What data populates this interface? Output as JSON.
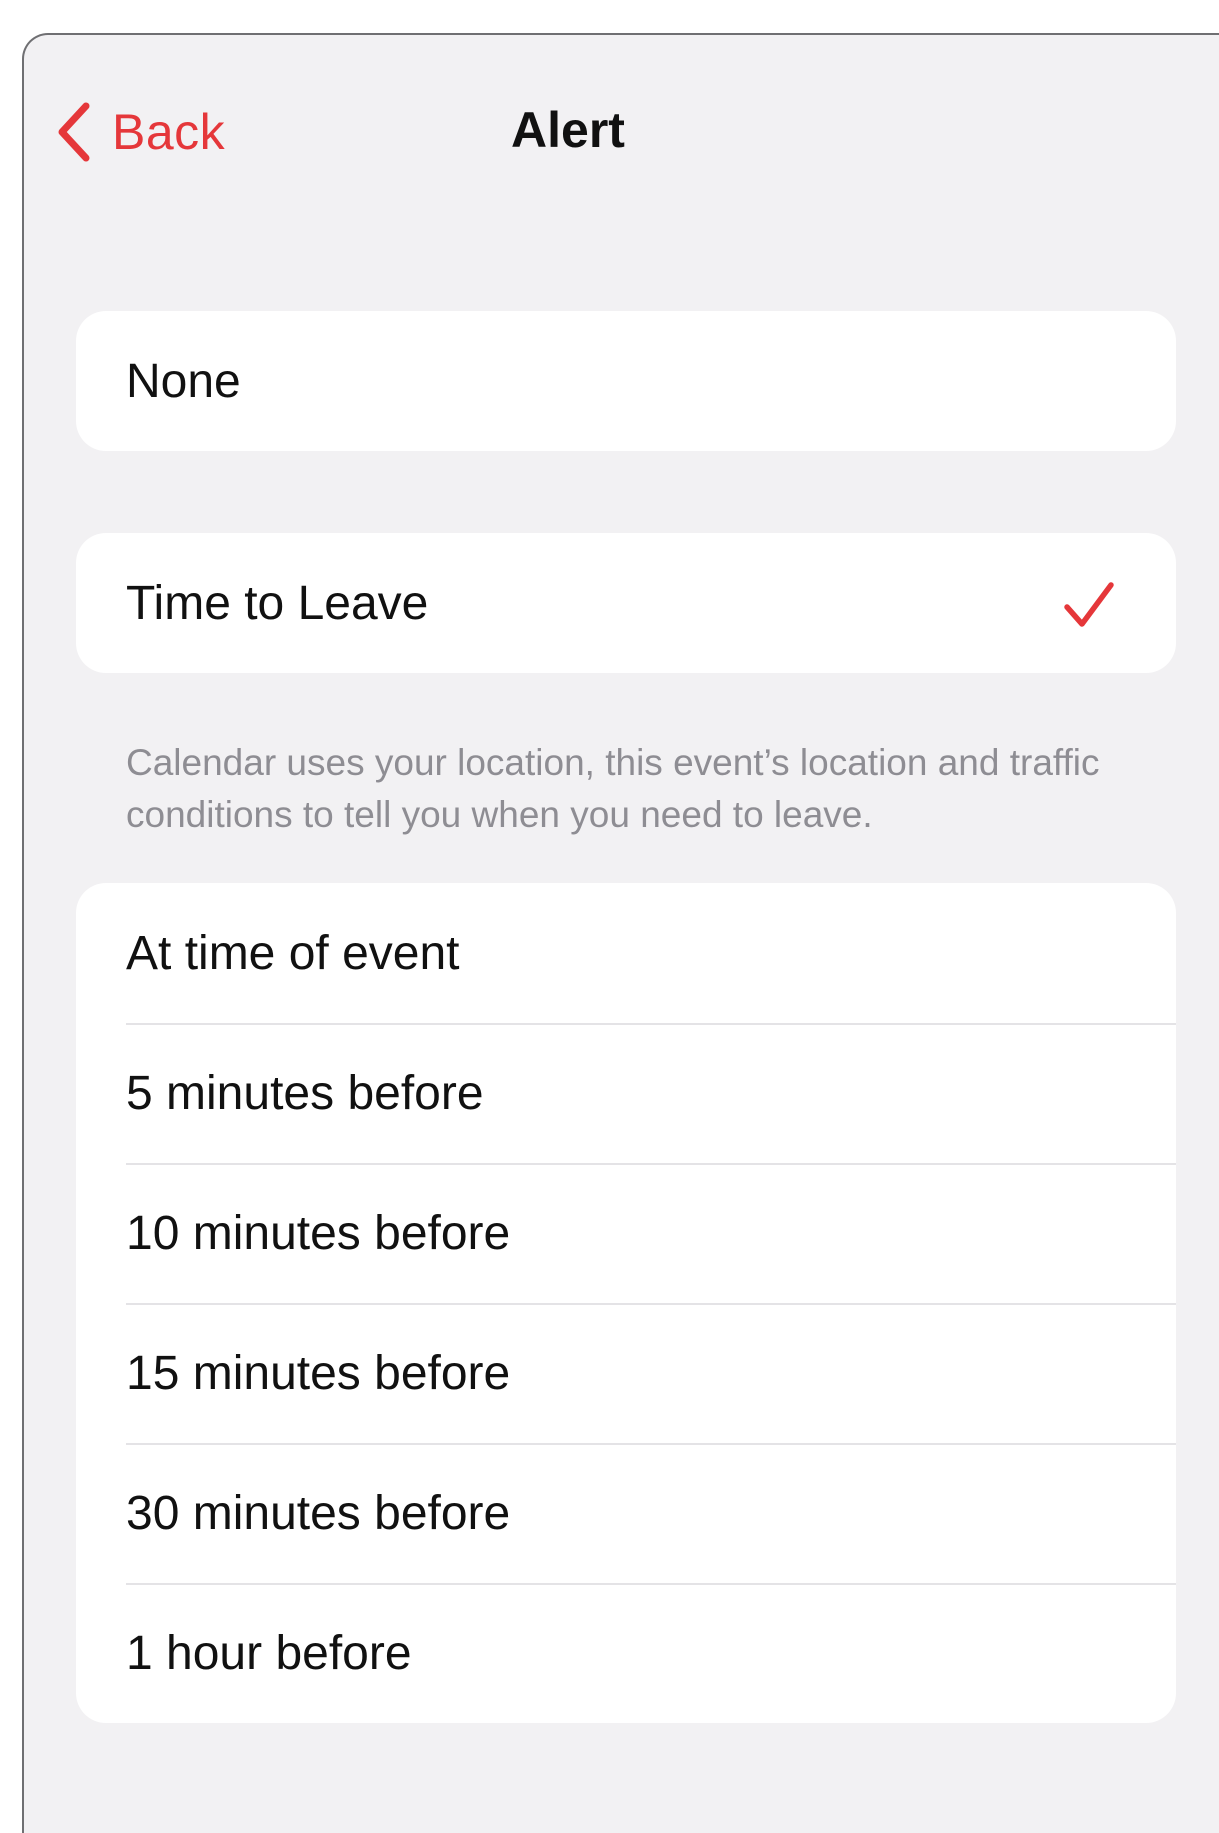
{
  "colors": {
    "accent": "#e5373a",
    "background": "#f2f1f3",
    "card": "#ffffff",
    "secondary_text": "#8e8d93"
  },
  "navbar": {
    "back_icon": "chevron-left-icon",
    "back_label": "Back",
    "title": "Alert"
  },
  "none_group": {
    "label": "None"
  },
  "time_to_leave_group": {
    "label": "Time to Leave",
    "selected": true,
    "check_icon": "checkmark-icon",
    "footnote": "Calendar uses your location, this event’s location and traffic conditions to tell you when you need to leave."
  },
  "options": [
    {
      "label": "At time of event"
    },
    {
      "label": "5 minutes before"
    },
    {
      "label": "10 minutes before"
    },
    {
      "label": "15 minutes before"
    },
    {
      "label": "30 minutes before"
    },
    {
      "label": "1 hour before"
    }
  ]
}
